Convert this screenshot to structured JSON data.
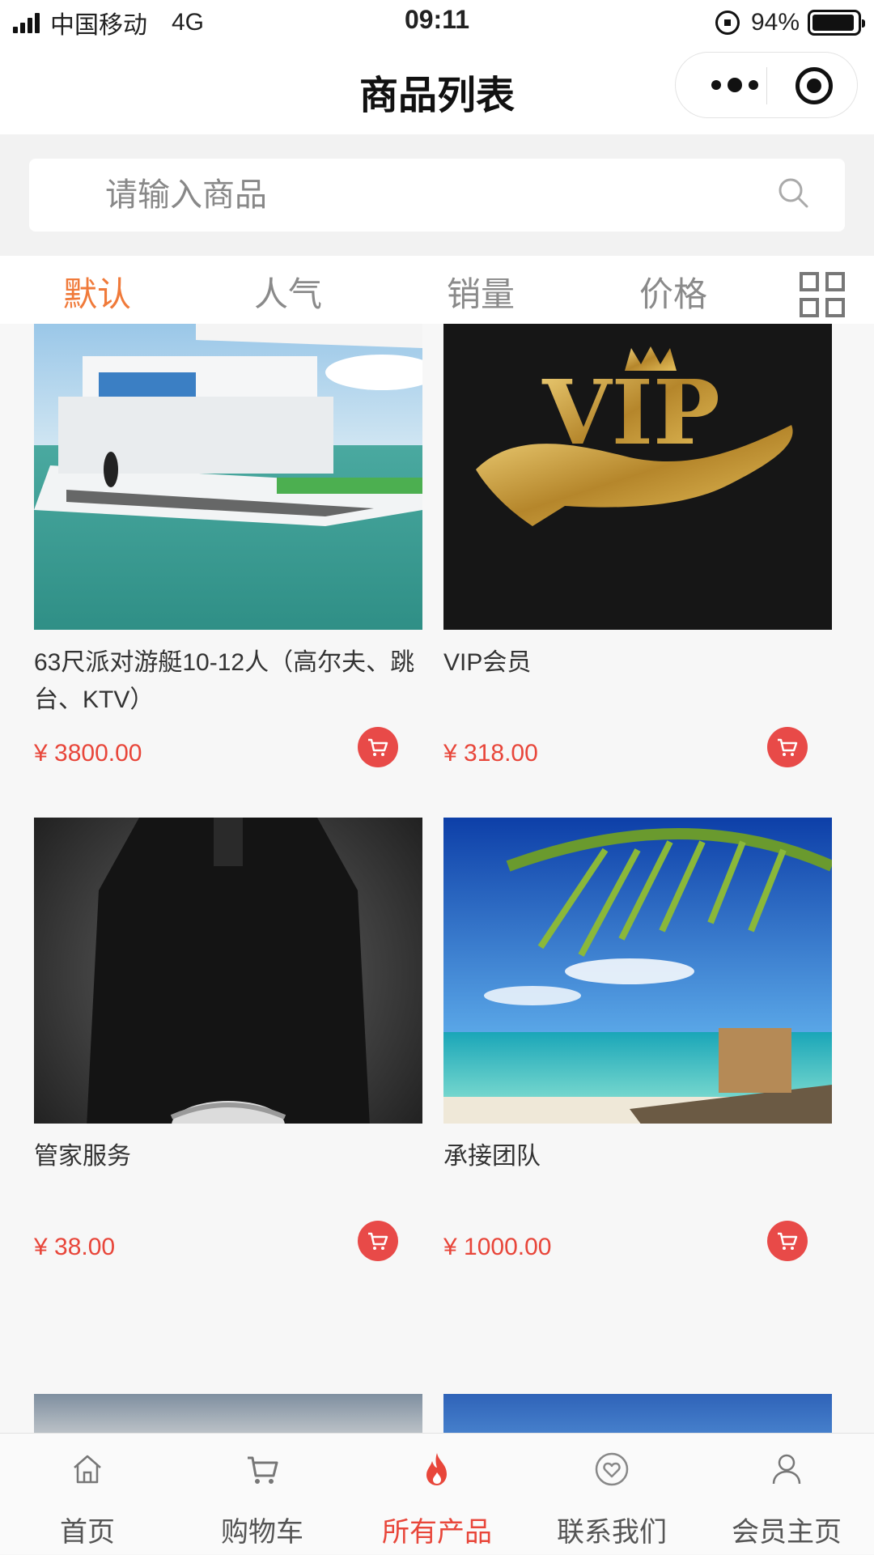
{
  "status_bar": {
    "carrier": "中国移动",
    "network": "4G",
    "time": "09:11",
    "battery": "94%"
  },
  "nav": {
    "title": "商品列表"
  },
  "search": {
    "placeholder": "请输入商品",
    "value": ""
  },
  "tabs": [
    {
      "label": "默认",
      "active": true
    },
    {
      "label": "人气",
      "active": false
    },
    {
      "label": "销量",
      "active": false
    },
    {
      "label": "价格",
      "active": false
    }
  ],
  "products": [
    {
      "title": "63尺派对游艇10-12人（高尔夫、跳台、KTV）",
      "price": "¥ 3800.00"
    },
    {
      "title": "VIP会员",
      "price": "¥ 318.00"
    },
    {
      "title": "管家服务",
      "price": "¥ 38.00"
    },
    {
      "title": "承接团队",
      "price": "¥ 1000.00"
    }
  ],
  "tabbar": [
    {
      "label": "首页",
      "icon": "home-icon"
    },
    {
      "label": "购物车",
      "icon": "cart-icon"
    },
    {
      "label": "所有产品",
      "icon": "fire-icon",
      "active": true
    },
    {
      "label": "联系我们",
      "icon": "heart-icon"
    },
    {
      "label": "会员主页",
      "icon": "user-icon"
    }
  ],
  "colors": {
    "accent": "#f07a3a",
    "price": "#e8463a",
    "cart_button": "#e84a48"
  }
}
